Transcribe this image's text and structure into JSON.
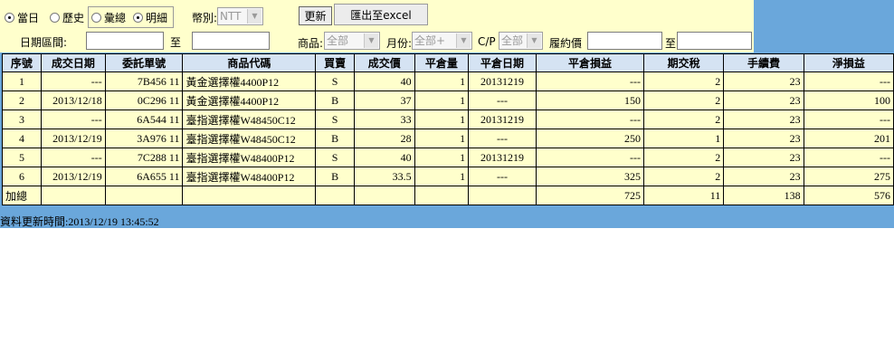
{
  "filters": {
    "mode_today": "當日",
    "mode_history": "歷史",
    "view_summary": "彙總",
    "view_detail": "明細",
    "currency_label": "幣別:",
    "currency_value": "NTT",
    "refresh_label": "更新",
    "export_label": "匯出至excel",
    "date_range_label": "日期區間:",
    "to_label": "至",
    "product_label": "商品:",
    "product_value": "全部",
    "month_label": "月份:",
    "month_value": "全部+",
    "cp_label": "C/P",
    "cp_value": "全部",
    "strike_label": "履約價",
    "strike_to_label": "至"
  },
  "table": {
    "headers": [
      "序號",
      "成交日期",
      "委託單號",
      "商品代碼",
      "買賣",
      "成交價",
      "平倉量",
      "平倉日期",
      "平倉損益",
      "期交稅",
      "手續費",
      "淨損益"
    ],
    "rows": [
      [
        "1",
        "---",
        "7B456 11",
        "黃金選擇權4400P12",
        "S",
        "40",
        "1",
        "20131219",
        "---",
        "2",
        "23",
        "---"
      ],
      [
        "2",
        "2013/12/18",
        "0C296 11",
        "黃金選擇權4400P12",
        "B",
        "37",
        "1",
        "---",
        "150",
        "2",
        "23",
        "100"
      ],
      [
        "3",
        "---",
        "6A544 11",
        "臺指選擇權W48450C12",
        "S",
        "33",
        "1",
        "20131219",
        "---",
        "2",
        "23",
        "---"
      ],
      [
        "4",
        "2013/12/19",
        "3A976 11",
        "臺指選擇權W48450C12",
        "B",
        "28",
        "1",
        "---",
        "250",
        "1",
        "23",
        "201"
      ],
      [
        "5",
        "---",
        "7C288 11",
        "臺指選擇權W48400P12",
        "S",
        "40",
        "1",
        "20131219",
        "---",
        "2",
        "23",
        "---"
      ],
      [
        "6",
        "2013/12/19",
        "6A655 11",
        "臺指選擇權W48400P12",
        "B",
        "33.5",
        "1",
        "---",
        "325",
        "2",
        "23",
        "275"
      ]
    ],
    "total": {
      "label": "加總",
      "close_pnl": "725",
      "tax": "11",
      "fee": "138",
      "net_pnl": "576"
    }
  },
  "footer": {
    "updated_text": "資料更新時間:2013/12/19 13:45:52"
  }
}
